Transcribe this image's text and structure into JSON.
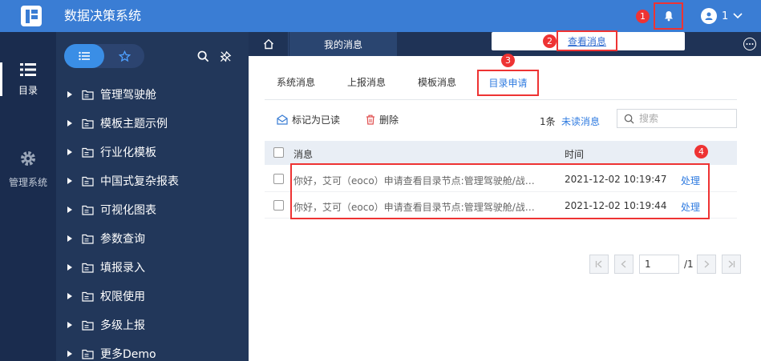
{
  "app": {
    "title": "数据决策系统"
  },
  "user": {
    "name": "1"
  },
  "leftnav": {
    "items": [
      {
        "label": "目录",
        "icon": "list-icon"
      },
      {
        "label": "管理系统",
        "icon": "gear-icon"
      }
    ]
  },
  "tree": {
    "items": [
      {
        "label": "管理驾驶舱"
      },
      {
        "label": "模板主题示例"
      },
      {
        "label": "行业化模板"
      },
      {
        "label": "中国式复杂报表"
      },
      {
        "label": "可视化图表"
      },
      {
        "label": "参数查询"
      },
      {
        "label": "填报录入"
      },
      {
        "label": "权限使用"
      },
      {
        "label": "多级上报"
      },
      {
        "label": "更多Demo"
      }
    ]
  },
  "tabbar": {
    "active_tab": "我的消息"
  },
  "popup": {
    "view_messages": "查看消息"
  },
  "subtabs": [
    {
      "label": "系统消息"
    },
    {
      "label": "上报消息"
    },
    {
      "label": "模板消息"
    },
    {
      "label": "目录申请"
    }
  ],
  "toolbar": {
    "mark_read": "标记为已读",
    "delete": "删除",
    "count": "1条",
    "unread": "未读消息",
    "search_placeholder": "搜索"
  },
  "table": {
    "headers": {
      "message": "消息",
      "time": "时间"
    },
    "rows": [
      {
        "message": "你好，艾可（eoco）申请查看目录节点:管理驾驶舱/战略…",
        "time": "2021-12-02 10:19:47",
        "action": "处理"
      },
      {
        "message": "你好，艾可（eoco）申请查看目录节点:管理驾驶舱/战略…",
        "time": "2021-12-02 10:19:44",
        "action": "处理"
      }
    ]
  },
  "pager": {
    "current": "1",
    "total": "/1"
  },
  "badges": [
    "1",
    "2",
    "3",
    "4"
  ],
  "colors": {
    "brand": "#3a7dd4",
    "accent": "#2f7be0",
    "highlight": "#e33333"
  }
}
